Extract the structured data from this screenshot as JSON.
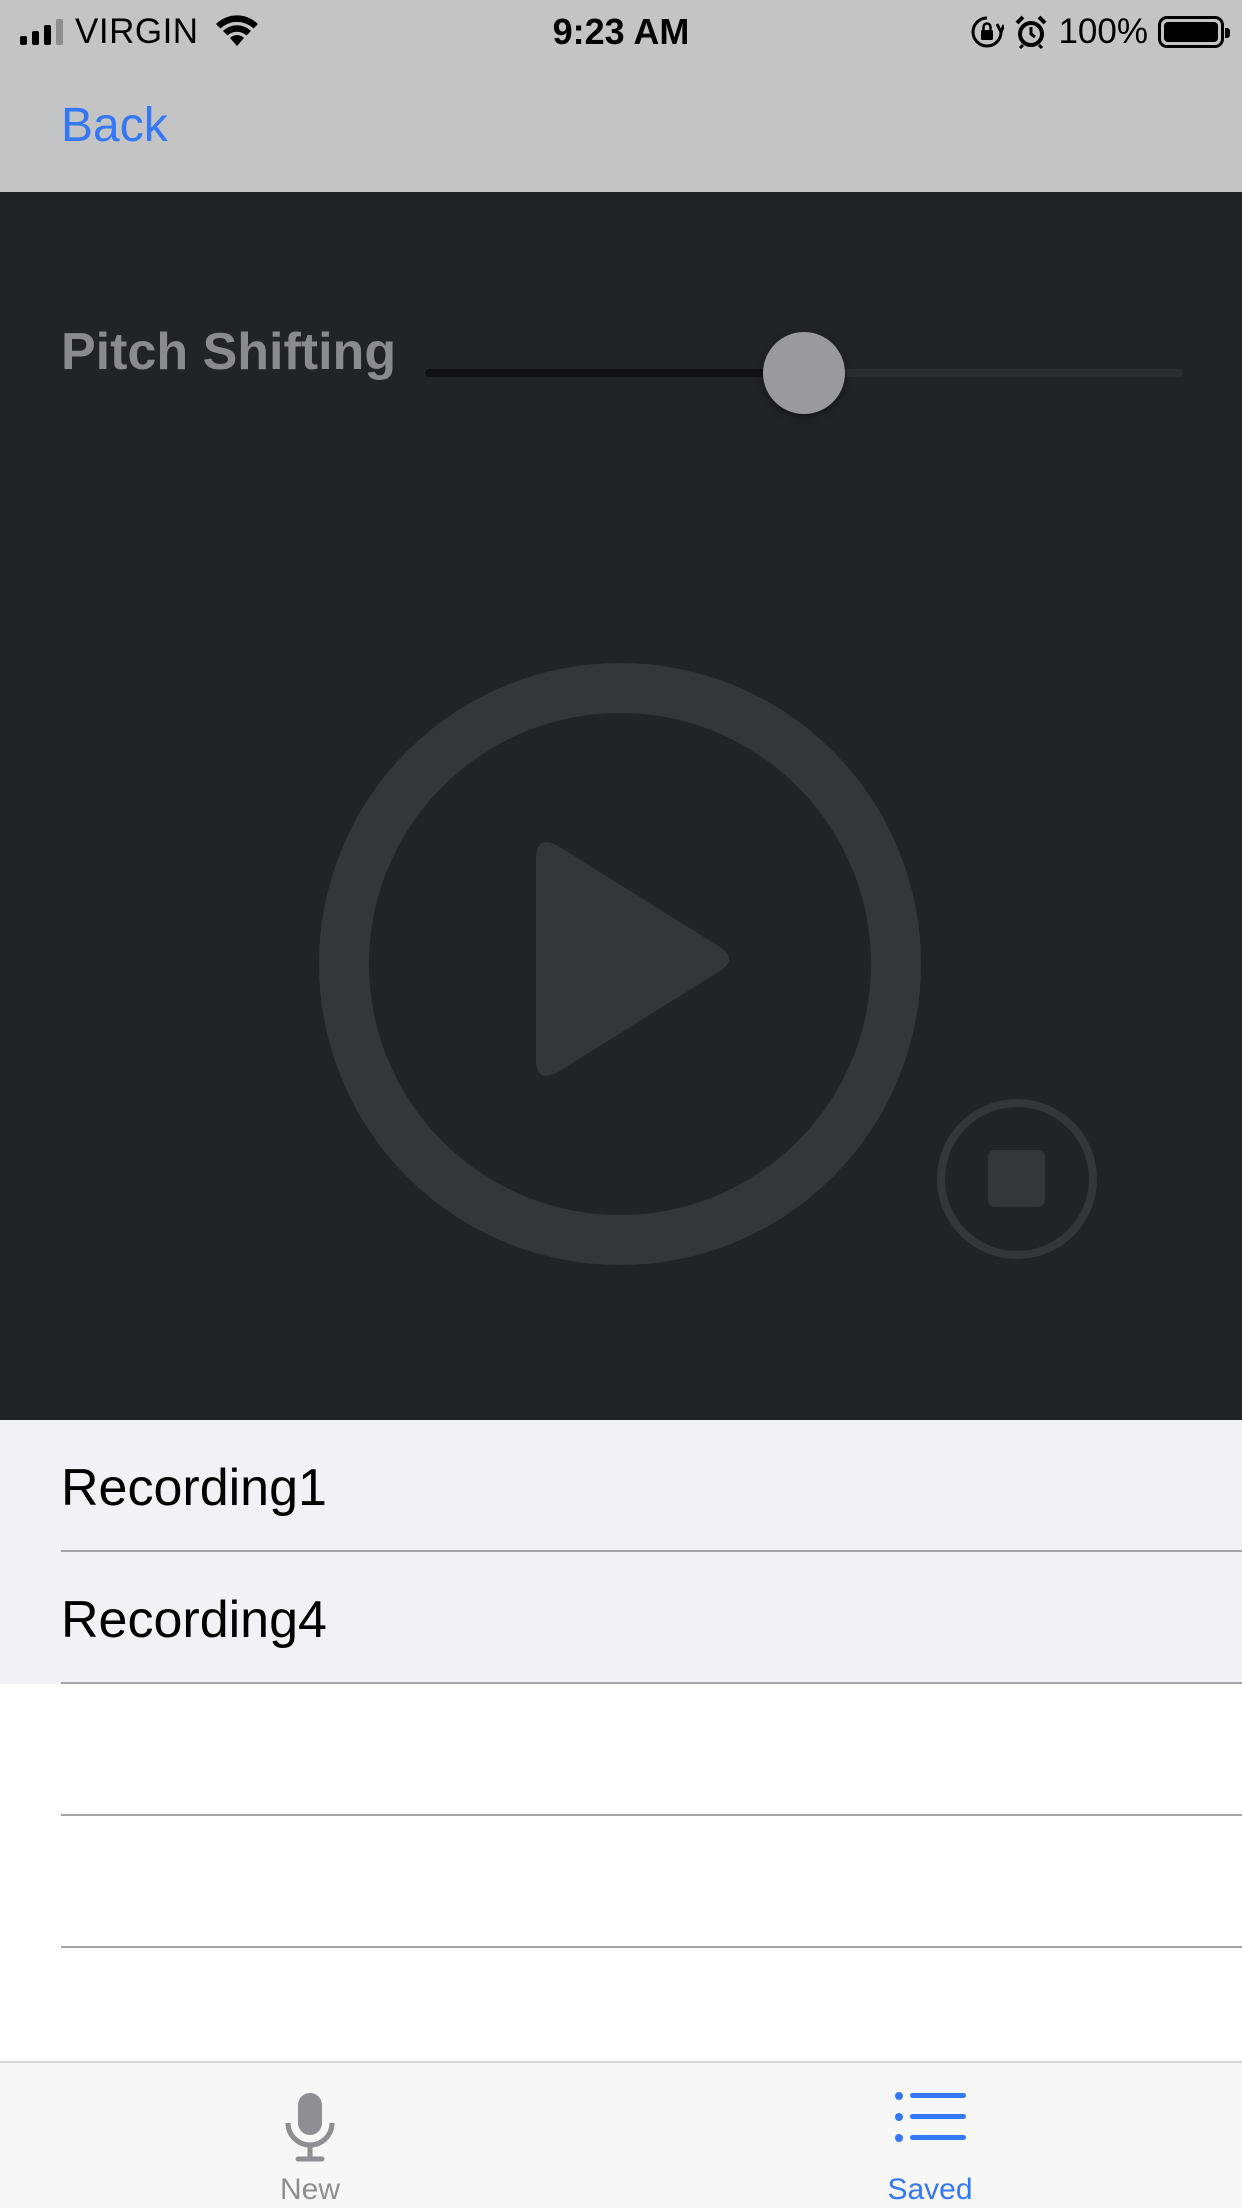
{
  "status_bar": {
    "carrier": "VIRGIN",
    "time": "9:23 AM",
    "battery": "100%",
    "icons": [
      "signal-icon",
      "wifi-icon",
      "orientation-lock-icon",
      "alarm-icon",
      "battery-icon"
    ]
  },
  "nav": {
    "back_label": "Back",
    "accent_color": "#3478f6"
  },
  "player": {
    "pitch_label": "Pitch Shifting",
    "pitch_value_fraction": 0.5,
    "play_icon": "play-icon",
    "stop_icon": "stop-icon"
  },
  "recordings": {
    "items": [
      {
        "label": "Recording1"
      },
      {
        "label": "Recording4"
      }
    ]
  },
  "tab_bar": {
    "tabs": [
      {
        "label": "New",
        "icon": "microphone-icon",
        "selected": false
      },
      {
        "label": "Saved",
        "icon": "list-icon",
        "selected": true
      }
    ]
  }
}
